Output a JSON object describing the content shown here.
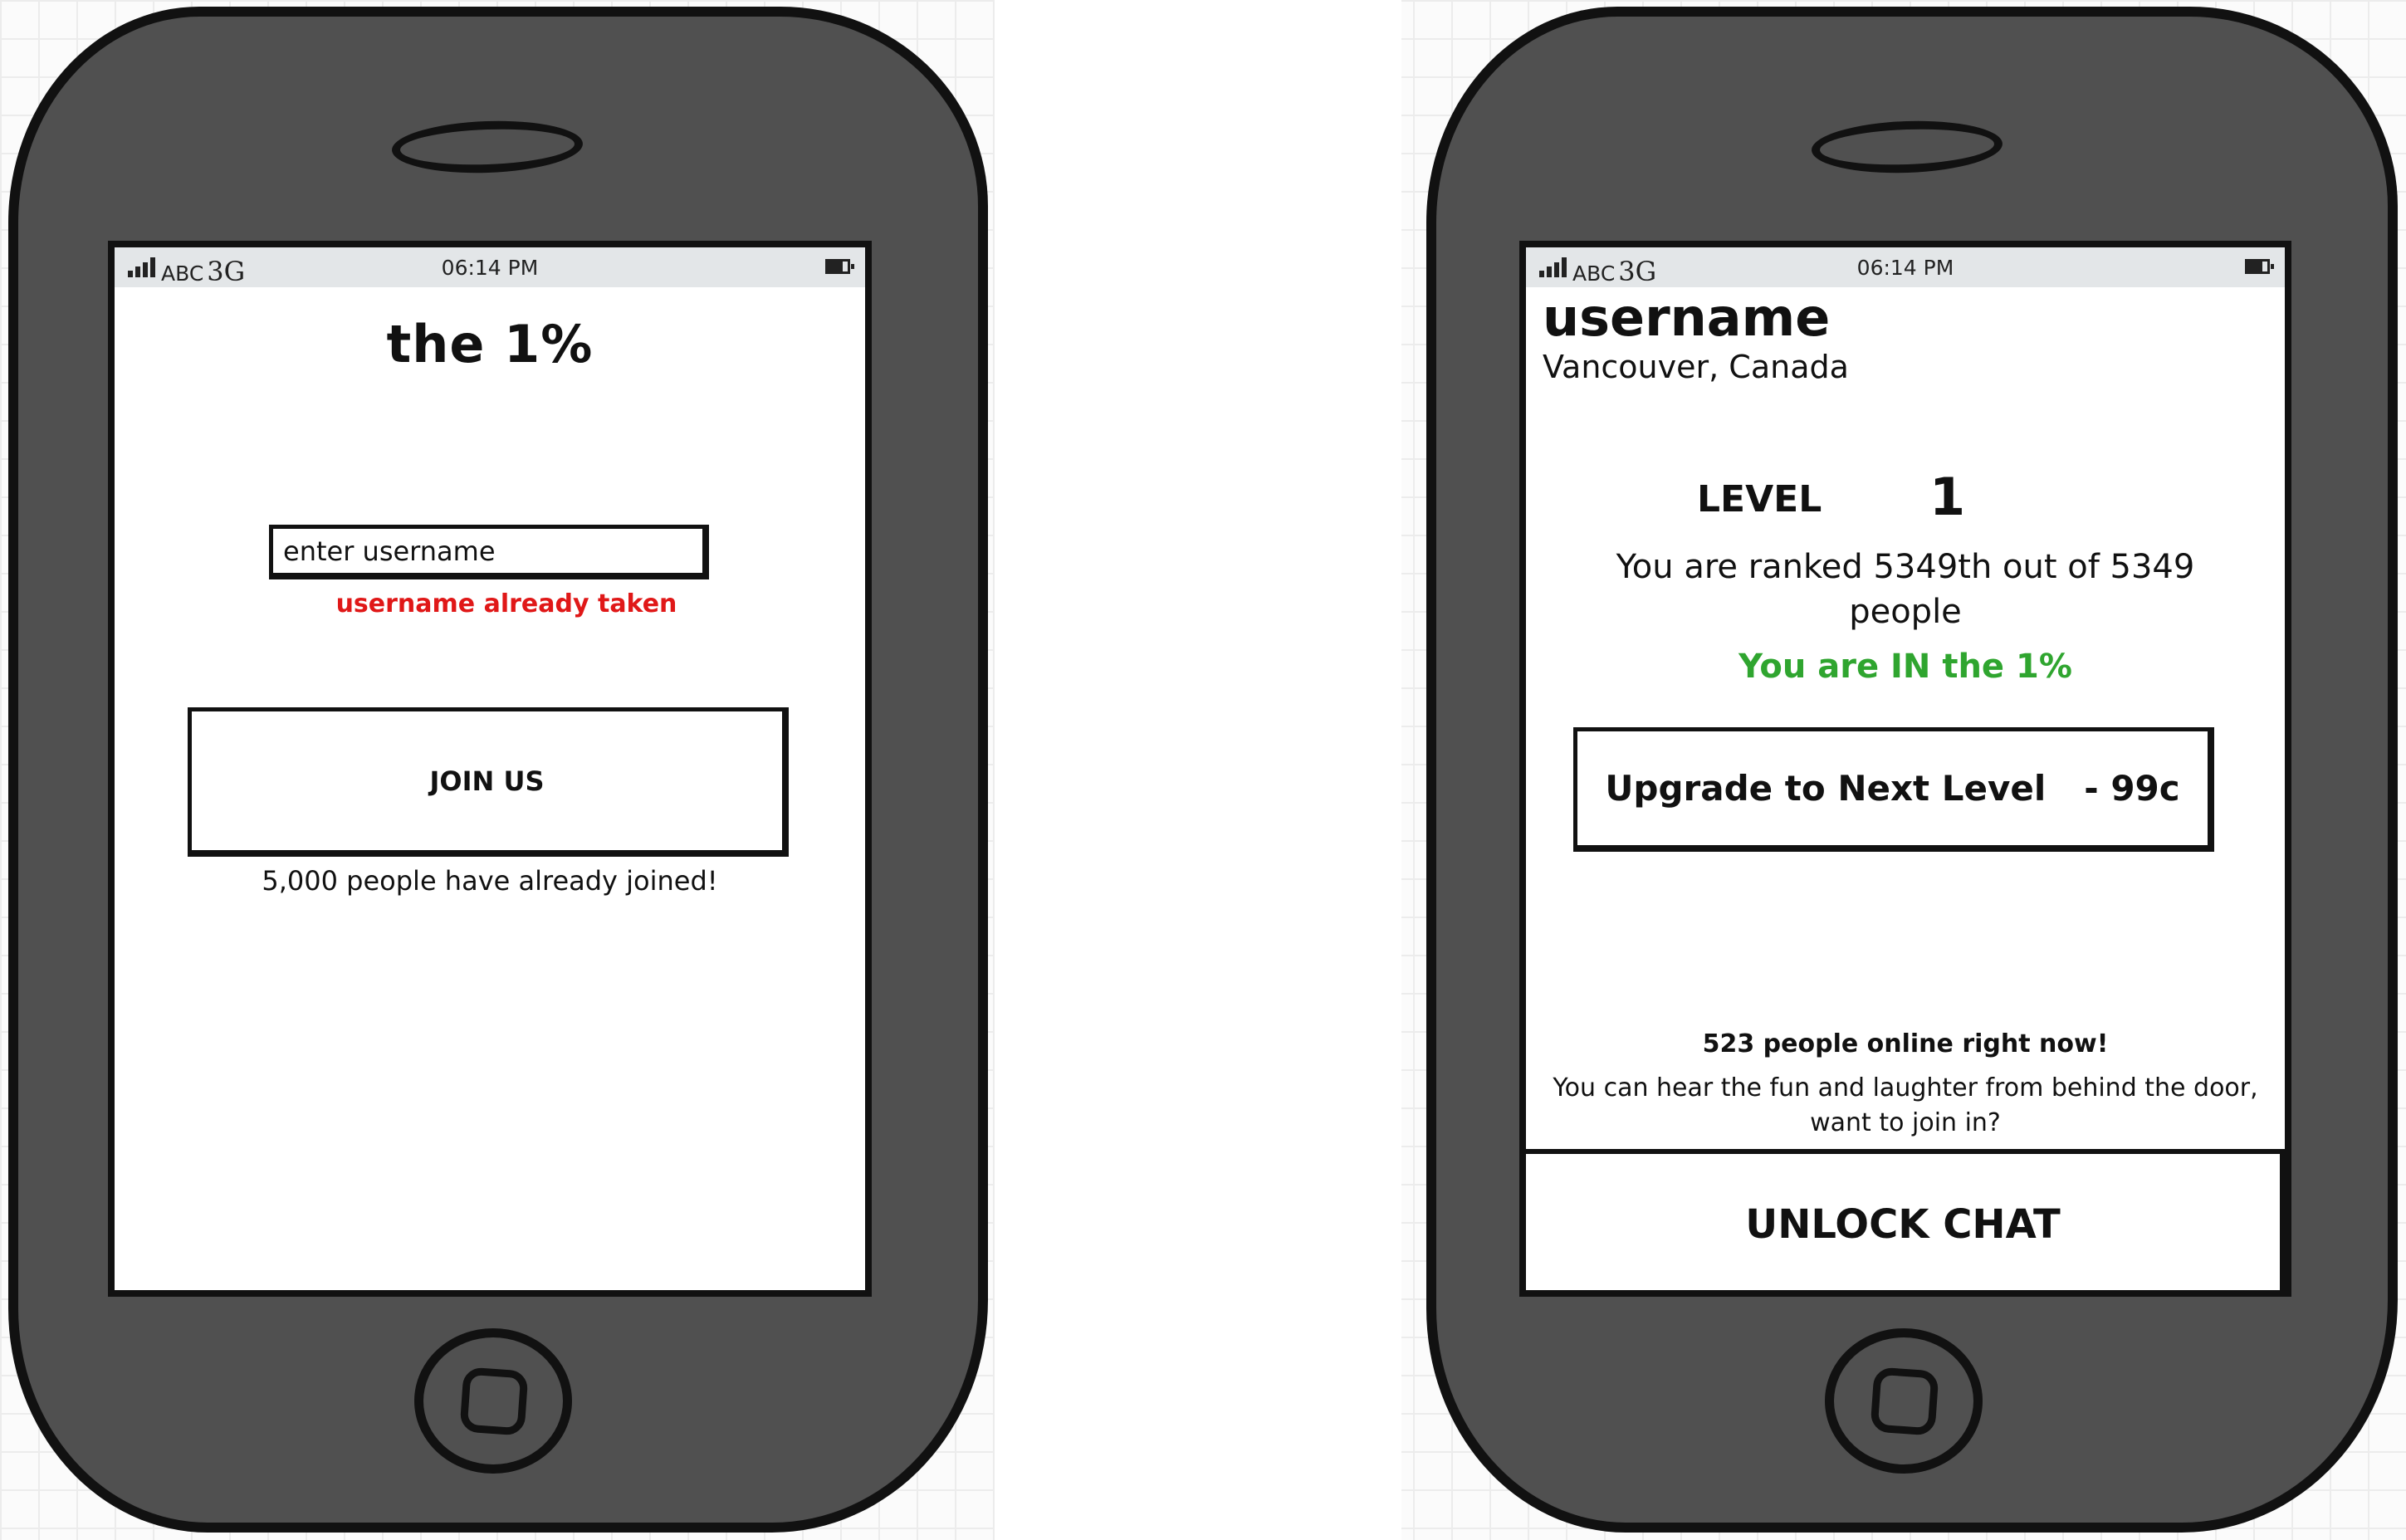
{
  "status_bar": {
    "carrier": "ABC",
    "network": "3G",
    "time": "06:14 PM"
  },
  "signup_screen": {
    "title": "the 1%",
    "username_input": {
      "value": "enter username"
    },
    "error": "username already taken",
    "join_button": "JOIN US",
    "joined_count": "5,000 people have already joined!"
  },
  "profile_screen": {
    "username": "username",
    "location": "Vancouver, Canada",
    "level_label": "LEVEL",
    "level_value": "1",
    "rank_text": "You are ranked 5349th out of 5349 people",
    "status": "You are IN the 1%",
    "upgrade_button": {
      "label": "Upgrade to Next Level",
      "price": "- 99c"
    },
    "online_count": "523 people online right now!",
    "invite_text": "You can hear the fun and laughter from behind the door, want to join in?",
    "unlock_button": "UNLOCK CHAT"
  },
  "colors": {
    "error": "#e01818",
    "success": "#2fa52f",
    "phone_body": "#505050"
  }
}
